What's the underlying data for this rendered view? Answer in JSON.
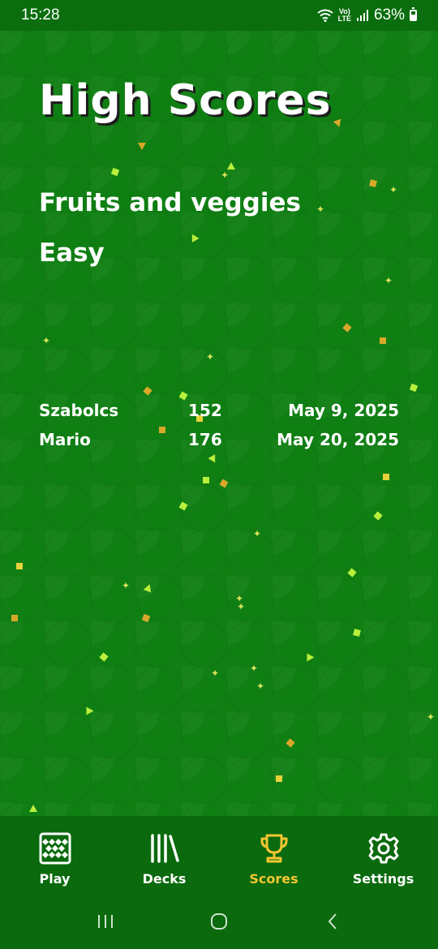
{
  "status_bar": {
    "time": "15:28",
    "network_top": "Vo)",
    "network_bottom": "LTE",
    "battery": "63%"
  },
  "screen": {
    "title": "High Scores",
    "deck_name": "Fruits and veggies",
    "difficulty": "Easy"
  },
  "scores": [
    {
      "name": "Szabolcs",
      "score": "152",
      "date": "May 9, 2025"
    },
    {
      "name": "Mario",
      "score": "176",
      "date": "May 20, 2025"
    }
  ],
  "nav": {
    "items": [
      {
        "label": "Play",
        "icon": "grid-board-icon",
        "active": false
      },
      {
        "label": "Decks",
        "icon": "library-books-icon",
        "active": false
      },
      {
        "label": "Scores",
        "icon": "trophy-icon",
        "active": true
      },
      {
        "label": "Settings",
        "icon": "gear-icon",
        "active": false
      }
    ]
  },
  "colors": {
    "background": "#0f7f13",
    "nav_background": "#0a6a0d",
    "active": "#f3c531",
    "text": "#ffffff"
  }
}
